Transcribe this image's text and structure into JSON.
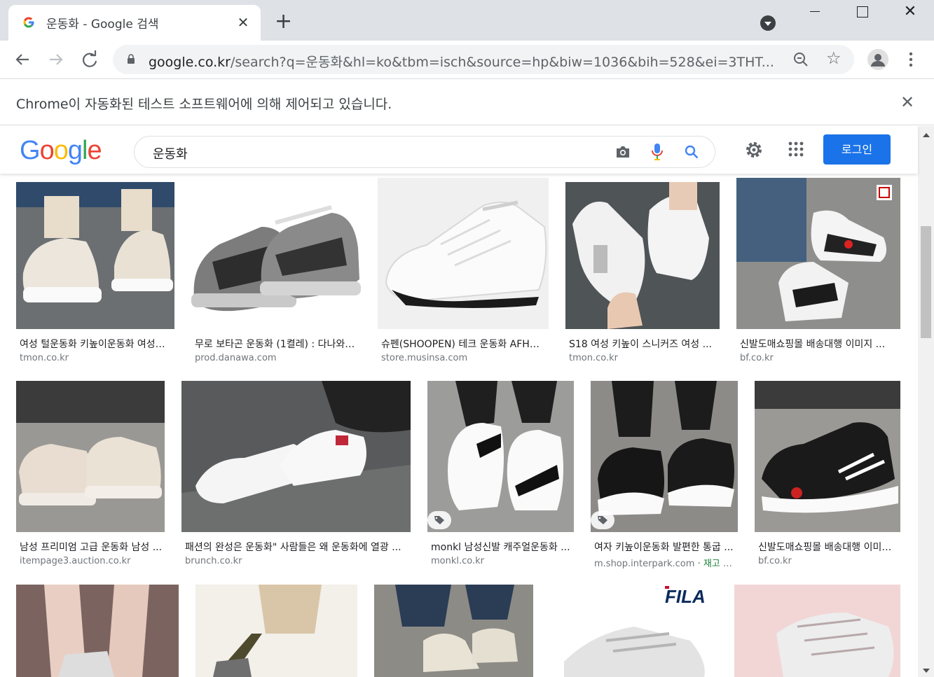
{
  "tab": {
    "title": "운동화 - Google 검색",
    "favicon": "google-g-icon"
  },
  "toolbar": {
    "url_host": "google.co.kr",
    "url_rest": "/search?q=운동화&hl=ko&tbm=isch&source=hp&biw=1036&bih=528&ei=3THT..."
  },
  "infobar": {
    "message": "Chrome이 자동화된 테스트 소프트웨어에 의해 제어되고 있습니다."
  },
  "google": {
    "logo_letters": [
      "G",
      "o",
      "o",
      "g",
      "l",
      "e"
    ],
    "query": "운동화",
    "login_label": "로그인",
    "colors": {
      "blue": "#4285f4",
      "red": "#ea4335",
      "yellow": "#fbbc05",
      "green": "#34a853",
      "button": "#1a73e8"
    }
  },
  "results": [
    {
      "caption": "여성 털운동화 키높이운동화 여성스니커즈 ...",
      "source": "tmon.co.kr"
    },
    {
      "caption": "무로 보타곤 운동화 (1켤레) : 다나와 ...",
      "source": "prod.danawa.com"
    },
    {
      "caption": "슈펜(SHOOPEN) 테크 운동화 AFHRF ...",
      "source": "store.musinsa.com"
    },
    {
      "caption": "S18 여성 키높이 스니커즈 여성 ...",
      "source": "tmon.co.kr"
    },
    {
      "caption": "신발도매쇼핑몰 배송대행 이미지 ...",
      "source": "bf.co.kr"
    },
    {
      "caption": "남성 프리미엄 고급 운동화 남성 ...",
      "source": "itempage3.auction.co.kr"
    },
    {
      "caption": "패션의 완성은 운동화\" 사람들은 왜 운동화에 열광 ...",
      "source": "brunch.co.kr"
    },
    {
      "caption": "monkl 남성신발 캐주얼운동화 ...",
      "source": "monkl.co.kr"
    },
    {
      "caption": "여자 키높이운동화 발편한 통굽 ...",
      "source": "m.shop.interpark.com",
      "source_extra": " · 재고 있음"
    },
    {
      "caption": "신발도매쇼핑몰 배송대행 이미지 ...",
      "source": "bf.co.kr"
    },
    {
      "caption": "",
      "source": ""
    },
    {
      "caption": "",
      "source": ""
    },
    {
      "caption": "",
      "source": ""
    },
    {
      "caption": "",
      "source": "",
      "brand": "FILA"
    },
    {
      "caption": "",
      "source": ""
    }
  ]
}
